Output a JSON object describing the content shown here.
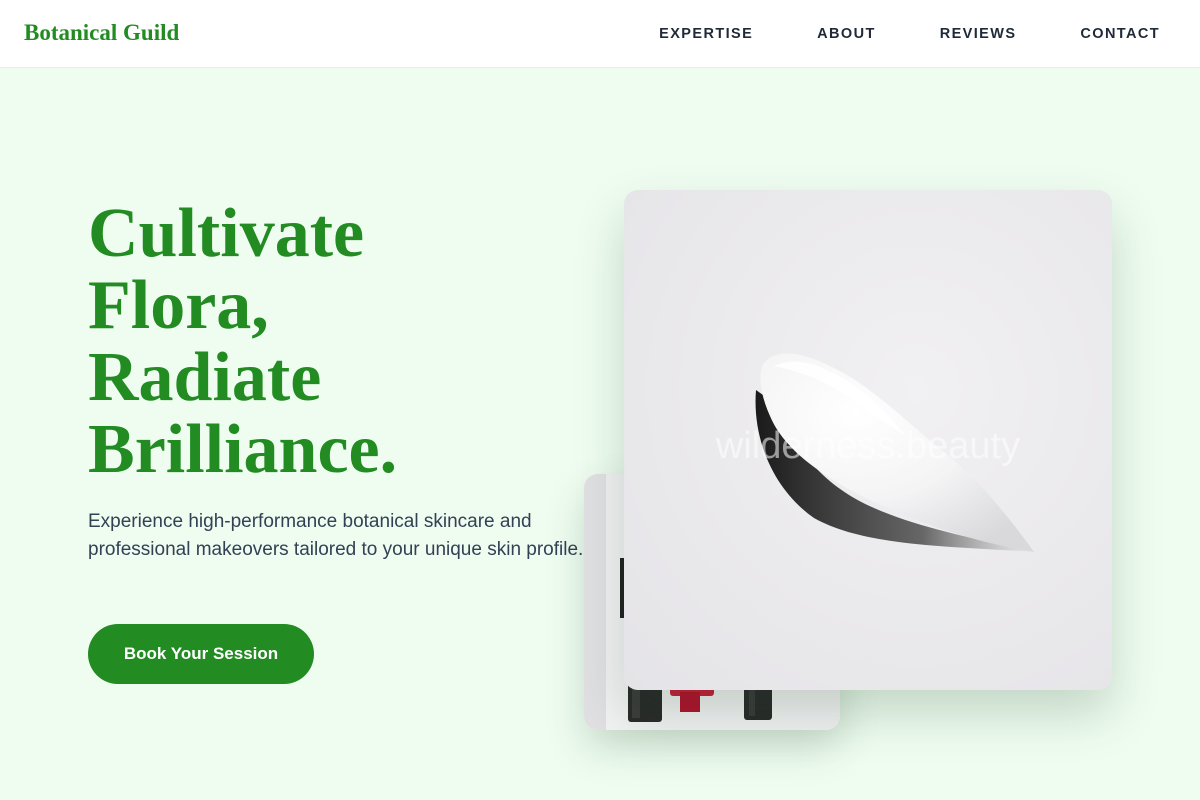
{
  "brand": {
    "name": "Botanical Guild",
    "color": "#228b22"
  },
  "nav": {
    "items": [
      {
        "label": "EXPERTISE"
      },
      {
        "label": "ABOUT"
      },
      {
        "label": "REVIEWS"
      },
      {
        "label": "CONTACT"
      }
    ]
  },
  "hero": {
    "headline_lines": [
      "Cultivate",
      "Flora,",
      "Radiate",
      "Brilliance."
    ],
    "subtext": "Experience high-performance botanical skincare and professional makeovers tailored to your unique skin profile.",
    "cta_label": "Book Your Session"
  },
  "images": {
    "front": {
      "semantic": "cream-swatch-photo",
      "watermark": "wilderness.beauty"
    },
    "back": {
      "semantic": "lipstick-tubes-photo"
    }
  },
  "colors": {
    "accent": "#228b22",
    "background": "#effdf1",
    "topbar": "#ffffff"
  }
}
